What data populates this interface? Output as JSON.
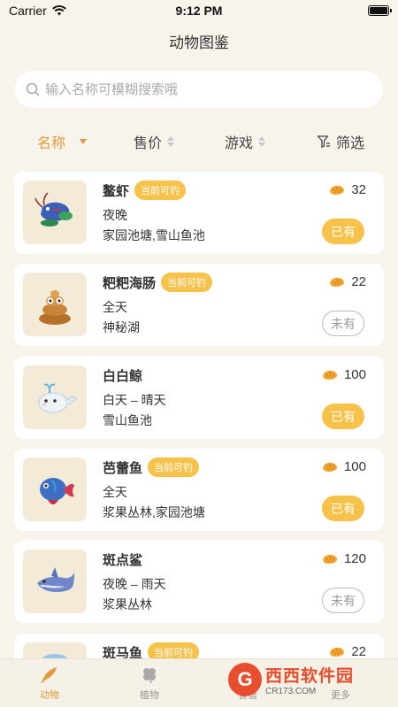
{
  "status": {
    "carrier": "Carrier",
    "time": "9:12 PM"
  },
  "title": "动物图鉴",
  "search": {
    "placeholder": "输入名称可模糊搜索哦",
    "value": ""
  },
  "filters": {
    "name": "名称",
    "price": "售价",
    "game": "游戏",
    "filter": "筛选"
  },
  "animals": [
    {
      "name": "鳌虾",
      "badge": "当前可钓",
      "time": "夜晚",
      "location": "家园池塘,雪山鱼池",
      "price": "32",
      "owned": "已有"
    },
    {
      "name": "粑粑海肠",
      "badge": "当前可钓",
      "time": "全天",
      "location": "神秘湖",
      "price": "22",
      "owned": "未有"
    },
    {
      "name": "白白鲸",
      "badge": "",
      "time": "白天 – 晴天",
      "location": "雪山鱼池",
      "price": "100",
      "owned": "已有"
    },
    {
      "name": "芭蕾鱼",
      "badge": "当前可钓",
      "time": "全天",
      "location": "浆果丛林,家园池塘",
      "price": "100",
      "owned": "已有"
    },
    {
      "name": "斑点鲨",
      "badge": "",
      "time": "夜晚 – 雨天",
      "location": "浆果丛林",
      "price": "120",
      "owned": "未有"
    },
    {
      "name": "斑马鱼",
      "badge": "当前可钓",
      "time": "",
      "location": "",
      "price": "22",
      "owned": ""
    }
  ],
  "tabs": {
    "animals": "动物",
    "plants": "植物",
    "food": "食谱",
    "more": "更多"
  },
  "watermark": {
    "main": "西西软件园",
    "sub": "CR173.COM",
    "logo": "G"
  },
  "colors": {
    "accent": "#e39a3c",
    "badge": "#f6c24a",
    "background": "#f8f4ec"
  }
}
